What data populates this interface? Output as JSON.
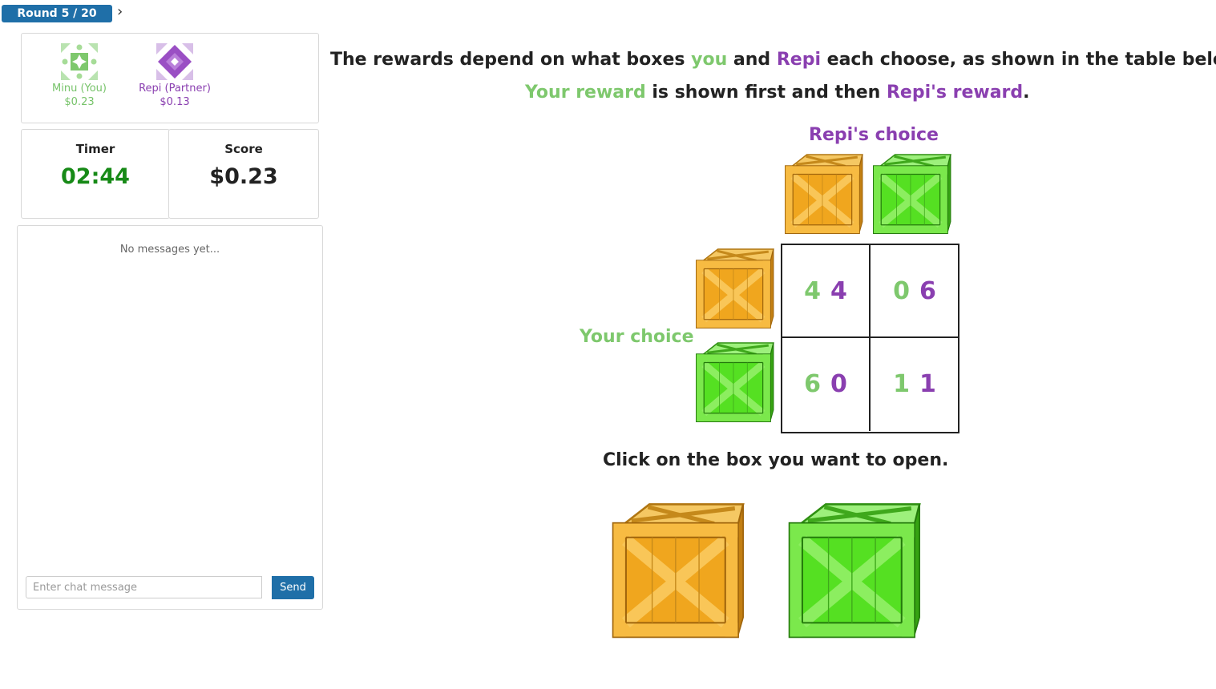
{
  "header": {
    "round_label": "Round 5 / 20"
  },
  "players": [
    {
      "name": "Minu (You)",
      "earnings": "$0.23",
      "icon": "green-quilt-avatar-icon",
      "color": "#77c36a"
    },
    {
      "name": "Repi (Partner)",
      "earnings": "$0.13",
      "icon": "purple-diamond-avatar-icon",
      "color": "#8a3fb0"
    }
  ],
  "timer": {
    "label": "Timer",
    "value": "02:44"
  },
  "score": {
    "label": "Score",
    "value": "$0.23"
  },
  "chat": {
    "empty_text": "No messages yet...",
    "placeholder": "Enter chat message",
    "send_label": "Send"
  },
  "instructions": {
    "line1": [
      "The rewards depend on what boxes ",
      "you",
      " and ",
      "Repi",
      " each choose, as shown in the table below."
    ],
    "line2": [
      "Your reward",
      " is shown first and then ",
      "Repi's reward",
      "."
    ]
  },
  "partner_choice_label": "Repi's choice",
  "your_choice_label": "Your choice",
  "payoff_matrix": [
    [
      {
        "you": "4",
        "partner": "4"
      },
      {
        "you": "0",
        "partner": "6"
      }
    ],
    [
      {
        "you": "6",
        "partner": "0"
      },
      {
        "you": "1",
        "partner": "1"
      }
    ]
  ],
  "box_colors": {
    "orange": "#f0a61e",
    "green": "#55e022"
  },
  "prompt": "Click on the box you want to open.",
  "choices": [
    {
      "name": "orange-box",
      "color": "orange"
    },
    {
      "name": "green-box",
      "color": "green"
    }
  ]
}
